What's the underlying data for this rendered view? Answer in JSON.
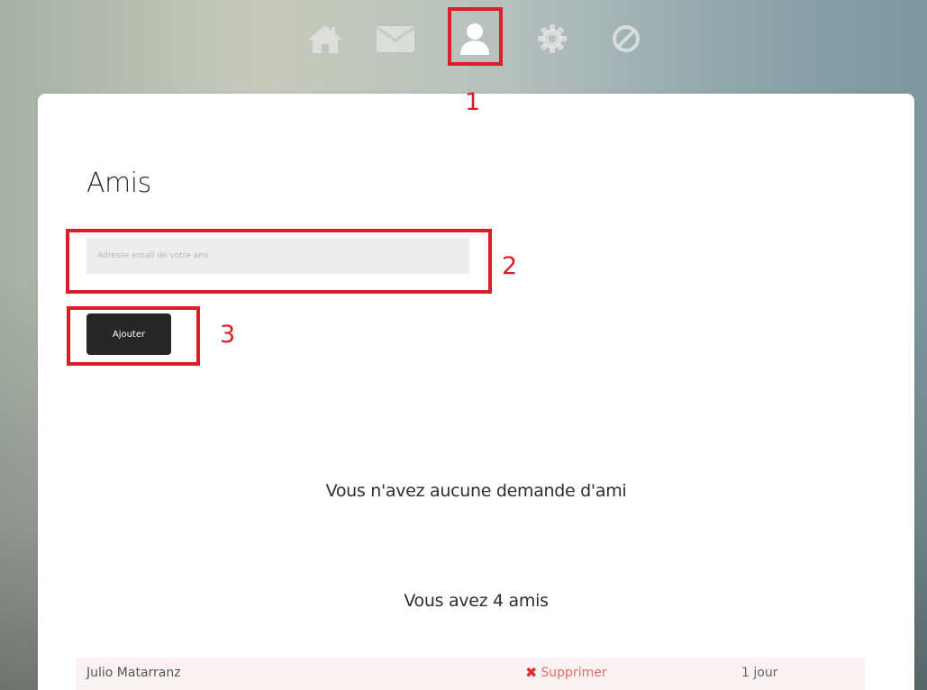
{
  "nav": {
    "items": [
      {
        "icon": "home-icon"
      },
      {
        "icon": "mail-icon"
      },
      {
        "icon": "user-icon",
        "active": true
      },
      {
        "icon": "gear-icon"
      },
      {
        "icon": "block-icon"
      }
    ]
  },
  "annotations": {
    "callout_1": "1",
    "callout_2": "2",
    "callout_3": "3",
    "color": "#d81f2a"
  },
  "friends_page": {
    "title": "Amis",
    "email_placeholder": "Adresse email de votre ami",
    "email_value": "",
    "add_button_label": "Ajouter",
    "requests_notice": "Vous n'avez aucune demande d'ami",
    "friends_count_text": "Vous avez 4 amis",
    "friends": [
      {
        "name": "Julio Matarranz",
        "delete_label": "Supprimer",
        "time": "1 jour"
      }
    ]
  }
}
